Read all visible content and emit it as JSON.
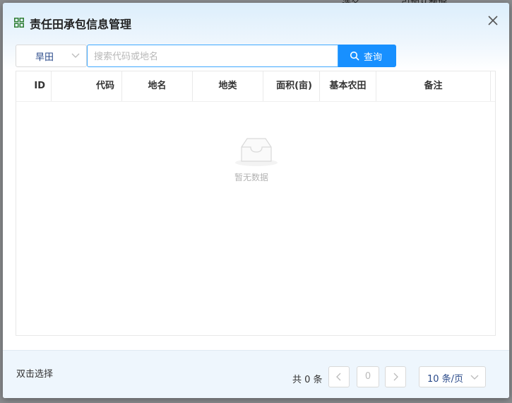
{
  "backdrop": {
    "text_1": "选名",
    "text_2": "引加从数据"
  },
  "dialog": {
    "title": "责任田承包信息管理",
    "icon": "grid-icon",
    "close_icon": "close-icon"
  },
  "toolbar": {
    "land_type": {
      "selected": "旱田"
    },
    "search": {
      "placeholder": "搜索代码或地名",
      "value": ""
    },
    "query_label": "查询"
  },
  "table": {
    "columns": [
      "ID",
      "代码",
      "地名",
      "地类",
      "面积(亩)",
      "基本农田",
      "备注"
    ],
    "rows": [],
    "empty_text": "暂无数据"
  },
  "footer": {
    "hint": "双击选择",
    "total": "共 0 条",
    "current_page": "0",
    "page_size": "10 条/页"
  },
  "colors": {
    "primary": "#1890ff",
    "title_icon": "#2e7d32",
    "border": "#d9d9d9"
  }
}
